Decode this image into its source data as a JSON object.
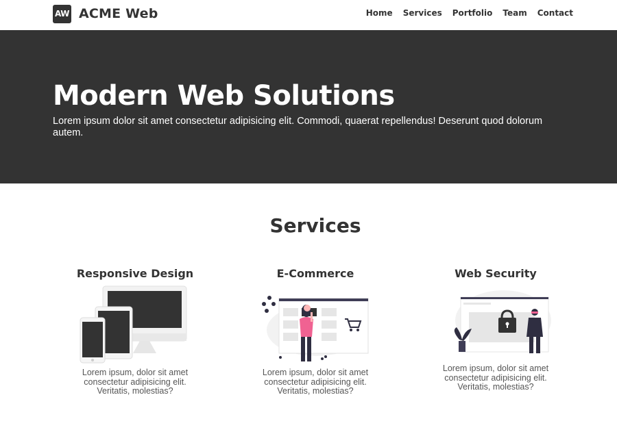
{
  "brand": {
    "logo_text": "AW",
    "name": "ACME Web"
  },
  "nav": {
    "links": [
      "Home",
      "Services",
      "Portfolio",
      "Team",
      "Contact"
    ]
  },
  "hero": {
    "title": "Modern Web Solutions",
    "text": "Lorem ipsum dolor sit amet consectetur adipisicing elit. Commodi, quaerat repellendus! Deserunt quod dolorum autem."
  },
  "services": {
    "heading": "Services",
    "cards": [
      {
        "title": "Responsive Design",
        "text": "Lorem ipsum, dolor sit amet consectetur adipisicing elit. Veritatis, molestias?",
        "illustration": "devices-illustration"
      },
      {
        "title": "E-Commerce",
        "text": "Lorem ipsum, dolor sit amet consectetur adipisicing elit. Veritatis, molestias?",
        "illustration": "shopping-illustration"
      },
      {
        "title": "Web Security",
        "text": "Lorem ipsum, dolor sit amet consectetur adipisicing elit. Veritatis, molestias?",
        "illustration": "security-illustration"
      }
    ]
  },
  "colors": {
    "dark": "#333333",
    "accent_pink": "#f06292",
    "navy": "#2f2e41",
    "light_gray": "#e6e6e6",
    "white": "#ffffff"
  }
}
